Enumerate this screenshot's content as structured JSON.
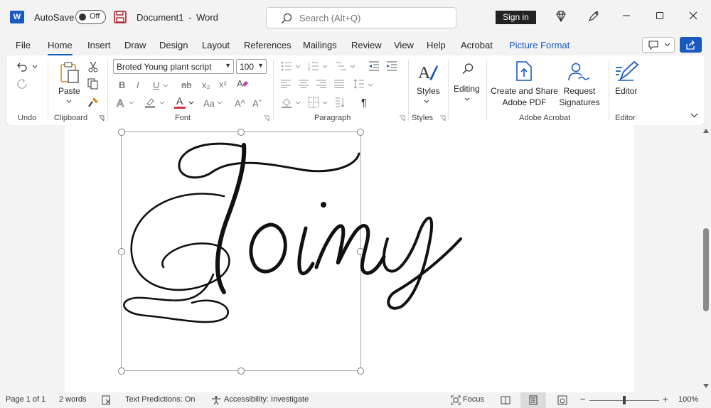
{
  "titlebar": {
    "app_logo": "W",
    "autosave_label": "AutoSave",
    "autosave_state": "Off",
    "document_title": "Document1",
    "title_separator": "-",
    "app_name": "Word",
    "search_placeholder": "Search (Alt+Q)",
    "sign_in": "Sign in",
    "icons": [
      "save-icon",
      "diamond-icon",
      "pen-icon",
      "minimize-icon",
      "maximize-icon",
      "close-icon"
    ]
  },
  "menu": {
    "tabs": [
      "File",
      "Home",
      "Insert",
      "Draw",
      "Design",
      "Layout",
      "References",
      "Mailings",
      "Review",
      "View",
      "Help",
      "Acrobat",
      "Picture Format"
    ],
    "active_tab": "Home",
    "accent_color": "#185abd"
  },
  "ribbon": {
    "undo_group": "Undo",
    "clipboard": {
      "paste": "Paste",
      "group": "Clipboard"
    },
    "font": {
      "family": "Broted Young plant script",
      "size": "100",
      "group": "Font",
      "bold": "B",
      "italic": "I",
      "underline": "U",
      "strike": "ab",
      "subscript": "x₂",
      "superscript": "x²",
      "font_color": "A",
      "font_color_value": "#d13438",
      "case": "Aa",
      "grow": "A^",
      "shrink": "Aˇ"
    },
    "paragraph": {
      "group": "Paragraph",
      "pilcrow": "¶"
    },
    "styles": {
      "label": "Styles",
      "group": "Styles"
    },
    "editing": {
      "label": "Editing"
    },
    "acrobat": {
      "create_line1": "Create and Share",
      "create_line2": "Adobe PDF",
      "request_line1": "Request",
      "request_line2": "Signatures",
      "group": "Adobe Acrobat"
    },
    "editor": {
      "label": "Editor",
      "group": "Editor"
    }
  },
  "document": {
    "text": "Toiny",
    "font_family": "Broted Young plant script"
  },
  "statusbar": {
    "page": "Page 1 of 1",
    "words": "2 words",
    "text_predictions": "Text Predictions: On",
    "accessibility": "Accessibility: Investigate",
    "focus": "Focus",
    "zoom_minus": "−",
    "zoom_plus": "+",
    "zoom_level": "100%"
  }
}
